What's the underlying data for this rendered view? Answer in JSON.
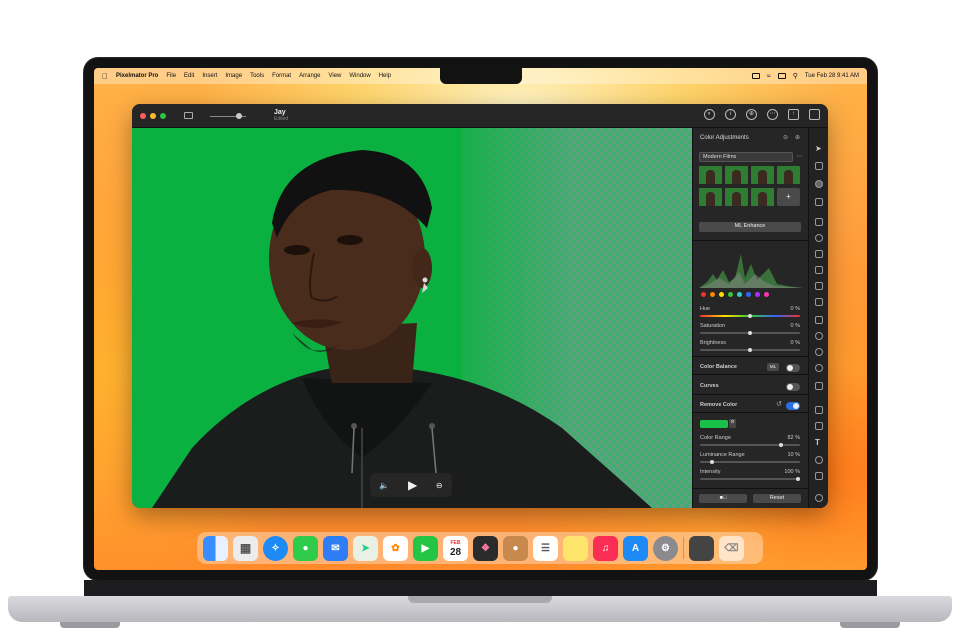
{
  "menubar": {
    "app_name": "Pixelmator Pro",
    "items": [
      "File",
      "Edit",
      "Insert",
      "Image",
      "Tools",
      "Format",
      "Arrange",
      "View",
      "Window",
      "Help"
    ],
    "datetime": "Tue Feb 28  9:41 AM"
  },
  "window": {
    "doc_title": "Jay",
    "doc_subtitle": "Edited"
  },
  "panel": {
    "title": "Color Adjustments",
    "preset_select": "Modern Films",
    "add_preset": "+",
    "ml_enhance": "ML Enhance",
    "sliders": [
      {
        "label": "Hue",
        "value": "0 %",
        "pos": 0.5
      },
      {
        "label": "Saturation",
        "value": "0 %",
        "pos": 0.5
      },
      {
        "label": "Brightness",
        "value": "0 %",
        "pos": 0.5
      }
    ],
    "color_balance": {
      "label": "Color Balance",
      "badge": "ML",
      "enabled": false
    },
    "curves": {
      "label": "Curves",
      "enabled": false
    },
    "remove_color": {
      "label": "Remove Color",
      "enabled": true
    },
    "remove_sliders": [
      {
        "label": "Color Range",
        "value": "82 %",
        "pos": 0.82
      },
      {
        "label": "Luminance Range",
        "value": "10 %",
        "pos": 0.1
      },
      {
        "label": "Intensity",
        "value": "100 %",
        "pos": 1.0
      }
    ],
    "reset": "Reset",
    "swatch_color": "#18c24a"
  },
  "dock": {
    "calendar_month": "FEB",
    "calendar_day": "28"
  },
  "colors": {
    "canvas_green": "#0bb140",
    "toggle_on": "#2b6ee6"
  }
}
